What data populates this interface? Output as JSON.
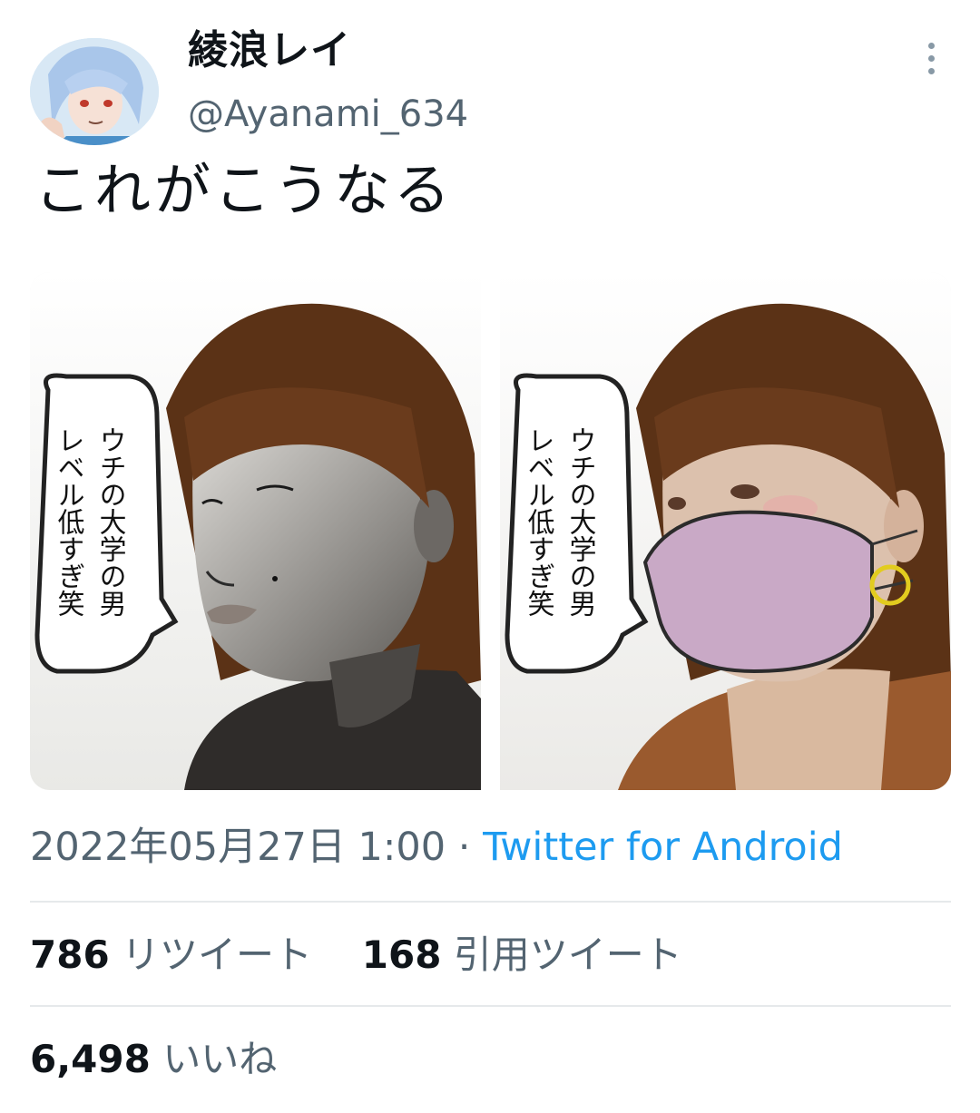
{
  "tweet": {
    "display_name": "綾浪レイ",
    "handle": "@Ayanami_634",
    "text": "これがこうなる",
    "speech_bubble_text": [
      "ウチの大学の男",
      "レベル低すぎ笑"
    ]
  },
  "meta": {
    "timestamp": "2022年05月27日 1:00",
    "separator": "·",
    "source": "Twitter for Android"
  },
  "stats": {
    "retweets_count": "786",
    "retweets_label": "リツイート",
    "quotes_count": "168",
    "quotes_label": "引用ツイート",
    "likes_count": "6,498",
    "likes_label": "いいね"
  },
  "colors": {
    "text": "#0f1419",
    "secondary": "#536471",
    "link": "#1d9bf0",
    "divider": "#e6e9eb"
  },
  "icons": [
    "more-icon"
  ]
}
